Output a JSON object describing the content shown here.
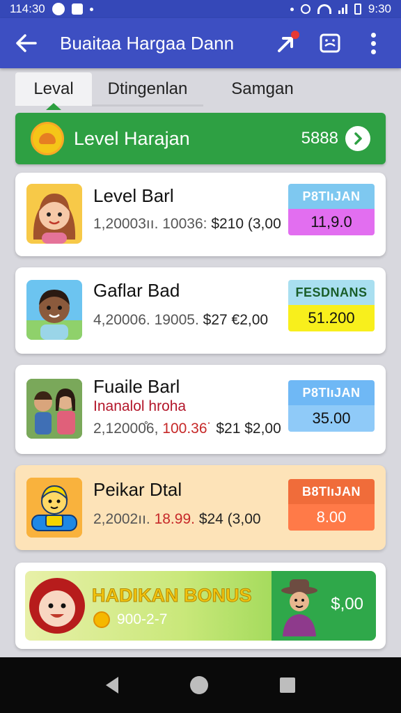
{
  "status_bar": {
    "time_left": "114:30",
    "time_right": "9:30"
  },
  "app_bar": {
    "title": "Buaitaa Hargaa Dann"
  },
  "tabs": [
    {
      "label": "Leval"
    },
    {
      "label": "Dtingenlan"
    },
    {
      "label": "Samgan"
    }
  ],
  "level_header": {
    "title": "Level Harajan",
    "value": "5888"
  },
  "cards": [
    {
      "title": "Level Barl",
      "line_a": "1,20003ıı. 10036:",
      "line_b": "$210 (3,00",
      "price_label": "P8TIıJAN",
      "price_value": "11,9.0"
    },
    {
      "title": "Gaflar Bad",
      "line_a": "4,20006. 19005.",
      "line_b": "$27 €2,00",
      "price_label": "FESDNANS",
      "price_value": "51.200"
    },
    {
      "title": "Fuaile Barl",
      "subtitle": "Inanalol hroha",
      "line_a": "2,12000̊6,",
      "line_red": "100.36˙",
      "line_b": "$21 $2,00",
      "price_label": "P8TIıJAN",
      "price_value": "35.00"
    },
    {
      "title": "Peikar Dtal",
      "line_a": "2,2002ıı.",
      "line_red": "18.99.",
      "line_b": "$24 (3,00",
      "price_label": "B8TIıJAN",
      "price_value": "8.00"
    }
  ],
  "bonus": {
    "title": "HADIKAN BONUS",
    "subtitle": "900-2-7",
    "price": "$,00"
  },
  "colors": {
    "primary": "#3d4fc2",
    "level_green": "#2ea043",
    "card1_label": "#7ec8f0",
    "card1_value": "#e26ef0",
    "card2_label": "#a9dff0",
    "card2_value": "#f8ef1c",
    "card3_label": "#6fb8f5",
    "card3_value": "#8fcaf8",
    "card4_label": "#f06c3a",
    "card4_value": "#ff7a48"
  }
}
